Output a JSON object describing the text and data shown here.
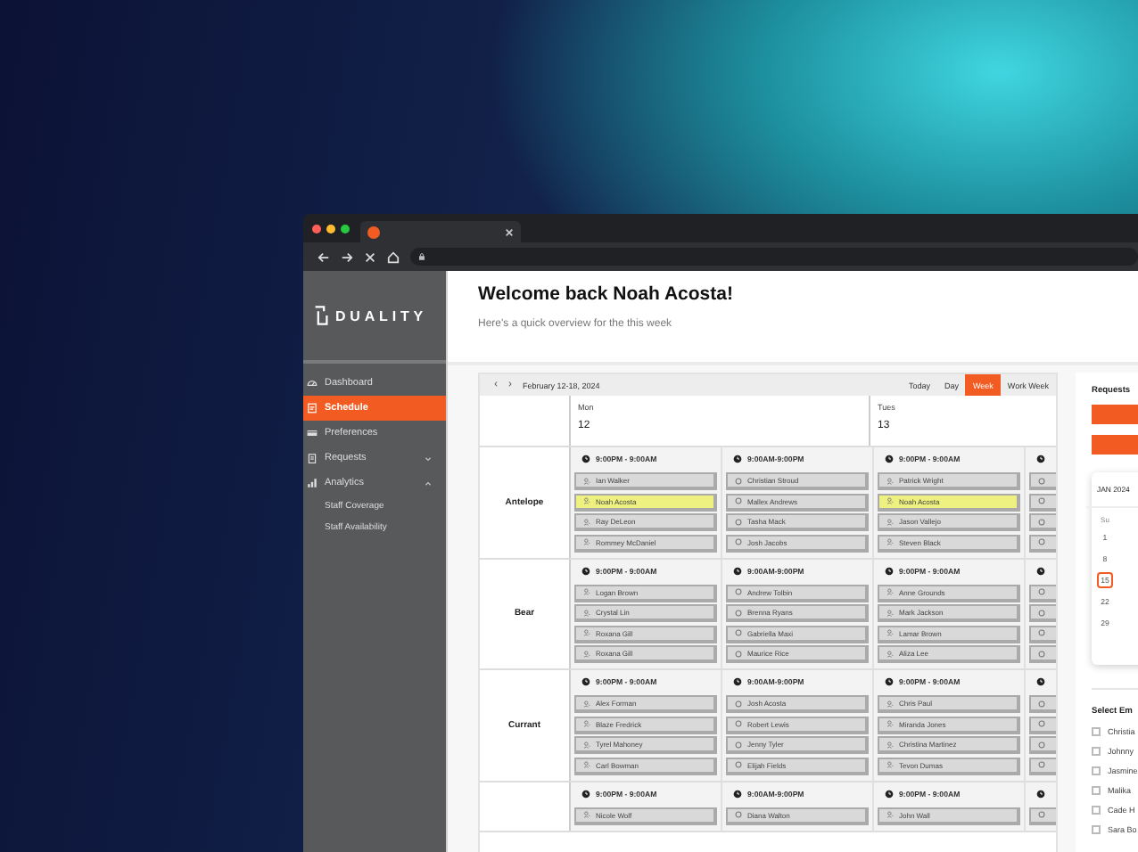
{
  "sidebar": {
    "logo": "DUALITY",
    "items": [
      {
        "label": "Dashboard",
        "selected": false
      },
      {
        "label": "Schedule",
        "selected": true
      },
      {
        "label": "Preferences",
        "selected": false
      },
      {
        "label": "Requests",
        "selected": false,
        "expanded": false
      },
      {
        "label": "Analytics",
        "selected": false,
        "expanded": true,
        "children": [
          {
            "label": "Staff Coverage"
          },
          {
            "label": "Staff Availability"
          }
        ]
      }
    ]
  },
  "header": {
    "title": "Welcome back Noah Acosta!",
    "subtitle": "Here's a quick overview for the this week"
  },
  "calendar": {
    "prev": "‹",
    "next": "›",
    "range": "February 12-18, 2024",
    "views": [
      {
        "label": "Today",
        "selected": false
      },
      {
        "label": "Day",
        "selected": false
      },
      {
        "label": "Week",
        "selected": true
      },
      {
        "label": "Work Week",
        "selected": false
      }
    ],
    "days": [
      {
        "name": "Mon",
        "date": "12"
      },
      {
        "name": "Tues",
        "date": "13"
      }
    ],
    "rows": [
      {
        "label": "Antelope",
        "shifts": [
          {
            "time": "9:00PM - 9:00AM",
            "kind": "night",
            "staff": [
              {
                "name": "Ian Walker",
                "highlighted": false
              },
              {
                "name": "Noah Acosta",
                "highlighted": true
              },
              {
                "name": "Ray DeLeon",
                "highlighted": false
              },
              {
                "name": "Rommey McDaniel",
                "highlighted": false
              }
            ]
          },
          {
            "time": "9:00AM-9:00PM",
            "kind": "day",
            "staff": [
              {
                "name": "Christian Stroud",
                "highlighted": false
              },
              {
                "name": "Mallex Andrews",
                "highlighted": false
              },
              {
                "name": "Tasha Mack",
                "highlighted": false
              },
              {
                "name": "Josh Jacobs",
                "highlighted": false
              }
            ]
          },
          {
            "time": "9:00PM - 9:00AM",
            "kind": "night",
            "staff": [
              {
                "name": "Patrick Wright",
                "highlighted": false
              },
              {
                "name": "Noah Acosta",
                "highlighted": true
              },
              {
                "name": "Jason Vallejo",
                "highlighted": false
              },
              {
                "name": "Steven Black",
                "highlighted": false
              }
            ]
          }
        ]
      },
      {
        "label": "Bear",
        "shifts": [
          {
            "time": "9:00PM - 9:00AM",
            "kind": "night",
            "staff": [
              {
                "name": "Logan Brown",
                "highlighted": false
              },
              {
                "name": "Crystal Lin",
                "highlighted": false
              },
              {
                "name": "Roxana Gill",
                "highlighted": false
              },
              {
                "name": "Roxana Gill",
                "highlighted": false
              }
            ]
          },
          {
            "time": "9:00AM-9:00PM",
            "kind": "day",
            "staff": [
              {
                "name": "Andrew Tolbin",
                "highlighted": false
              },
              {
                "name": "Brenna Ryans",
                "highlighted": false
              },
              {
                "name": "Gabriella Maxi",
                "highlighted": false
              },
              {
                "name": "Maurice Rice",
                "highlighted": false
              }
            ]
          },
          {
            "time": "9:00PM - 9:00AM",
            "kind": "night",
            "staff": [
              {
                "name": "Anne Grounds",
                "highlighted": false
              },
              {
                "name": "Mark Jackson",
                "highlighted": false
              },
              {
                "name": "Lamar Brown",
                "highlighted": false
              },
              {
                "name": "Aliza Lee",
                "highlighted": false
              }
            ]
          }
        ]
      },
      {
        "label": "Currant",
        "shifts": [
          {
            "time": "9:00PM - 9:00AM",
            "kind": "night",
            "staff": [
              {
                "name": "Alex Forman",
                "highlighted": false
              },
              {
                "name": "Blaze Fredrick",
                "highlighted": false
              },
              {
                "name": "Tyrel Mahoney",
                "highlighted": false
              },
              {
                "name": "Carl Bowman",
                "highlighted": false
              }
            ]
          },
          {
            "time": "9:00AM-9:00PM",
            "kind": "day",
            "staff": [
              {
                "name": "Josh Acosta",
                "highlighted": false
              },
              {
                "name": "Robert Lewis",
                "highlighted": false
              },
              {
                "name": "Jenny Tyler",
                "highlighted": false
              },
              {
                "name": "Elijah Fields",
                "highlighted": false
              }
            ]
          },
          {
            "time": "9:00PM - 9:00AM",
            "kind": "night",
            "staff": [
              {
                "name": "Chris Paul",
                "highlighted": false
              },
              {
                "name": "Miranda Jones",
                "highlighted": false
              },
              {
                "name": "Christina Martinez",
                "highlighted": false
              },
              {
                "name": "Tevon Dumas",
                "highlighted": false
              }
            ]
          }
        ]
      },
      {
        "shifts": [
          {
            "time": "9:00PM - 9:00AM",
            "kind": "night",
            "staff": [
              {
                "name": "Nicole Wolf",
                "highlighted": false
              }
            ]
          },
          {
            "time": "9:00AM-9:00PM",
            "kind": "day",
            "staff": [
              {
                "name": "Diana Walton",
                "highlighted": false
              }
            ]
          },
          {
            "time": "9:00PM - 9:00AM",
            "kind": "night",
            "staff": [
              {
                "name": "John Wall",
                "highlighted": false
              }
            ]
          }
        ]
      }
    ]
  },
  "panel": {
    "title": "Requests",
    "month": "JAN 2024",
    "weekday": "Su",
    "dates": [
      {
        "label": "1",
        "selected": false
      },
      {
        "label": "8",
        "selected": false
      },
      {
        "label": "15",
        "selected": true
      },
      {
        "label": "22",
        "selected": false
      },
      {
        "label": "29",
        "selected": false
      }
    ],
    "employees_title": "Select Em",
    "employees": [
      {
        "name": "Christia",
        "checked": false
      },
      {
        "name": "Johnny",
        "checked": false
      },
      {
        "name": "Jasmine",
        "checked": false
      },
      {
        "name": "Malika",
        "checked": false
      },
      {
        "name": "Cade H",
        "checked": false
      },
      {
        "name": "Sara Bo",
        "checked": false
      }
    ]
  }
}
